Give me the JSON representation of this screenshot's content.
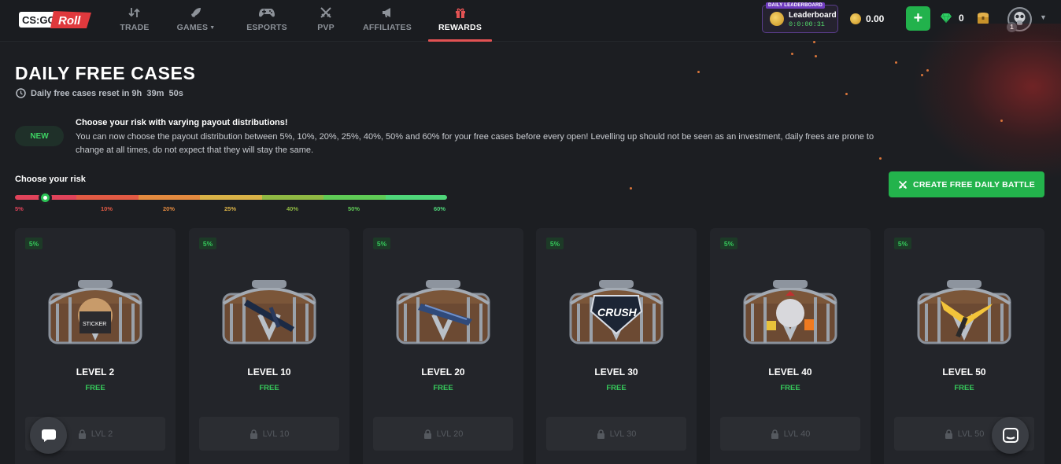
{
  "brand": {
    "logo_text_left": "CS:GO",
    "logo_text_right": "Roll"
  },
  "nav": {
    "items": [
      {
        "label": "TRADE",
        "icon": "trade-arrows-icon"
      },
      {
        "label": "GAMES",
        "icon": "rocket-icon"
      },
      {
        "label": "ESPORTS",
        "icon": "gamepad-icon"
      },
      {
        "label": "PVP",
        "icon": "crossed-swords-icon"
      },
      {
        "label": "AFFILIATES",
        "icon": "megaphone-icon"
      },
      {
        "label": "REWARDS",
        "icon": "gift-icon"
      }
    ],
    "active": "REWARDS"
  },
  "leaderboard": {
    "tag": "DAILY LEADERBOARD",
    "title": "Leaderboard",
    "timer": "0:0:00:31"
  },
  "wallet": {
    "balance": "0.00",
    "gems": "0"
  },
  "user": {
    "level": "1"
  },
  "page": {
    "title": "DAILY FREE CASES",
    "reset_text": "Daily free cases reset in 9h  39m  50s"
  },
  "notice": {
    "badge": "NEW",
    "title": "Choose your risk with varying payout distributions!",
    "body": "You can now choose the payout distribution between 5%, 10%, 20%, 25%, 40%, 50% and 60% for your free cases before every open! Levelling up should not be seen as an investment, daily frees are prone to change at all times, do not expect that they will stay the same."
  },
  "risk": {
    "title": "Choose your risk",
    "selected_index": 0,
    "labels": [
      "5%",
      "10%",
      "20%",
      "25%",
      "40%",
      "50%",
      "60%"
    ],
    "colors": [
      "#e0435a",
      "#e25a44",
      "#e38a3f",
      "#d9b247",
      "#8fb843",
      "#5fcb56",
      "#4fd67a"
    ]
  },
  "battle_button": {
    "label": "CREATE FREE DAILY BATTLE"
  },
  "cases": [
    {
      "badge": "5%",
      "level": "LEVEL 2",
      "price": "FREE",
      "lock": "LVL 2"
    },
    {
      "badge": "5%",
      "level": "LEVEL 10",
      "price": "FREE",
      "lock": "LVL 10"
    },
    {
      "badge": "5%",
      "level": "LEVEL 20",
      "price": "FREE",
      "lock": "LVL 20"
    },
    {
      "badge": "5%",
      "level": "LEVEL 30",
      "price": "FREE",
      "lock": "LVL 30"
    },
    {
      "badge": "5%",
      "level": "LEVEL 40",
      "price": "FREE",
      "lock": "LVL 40"
    },
    {
      "badge": "5%",
      "level": "LEVEL 50",
      "price": "FREE",
      "lock": "LVL 50"
    }
  ],
  "colors": {
    "accent_green": "#23b34c",
    "accent_red": "#e25253",
    "bg": "#1c1e22"
  }
}
